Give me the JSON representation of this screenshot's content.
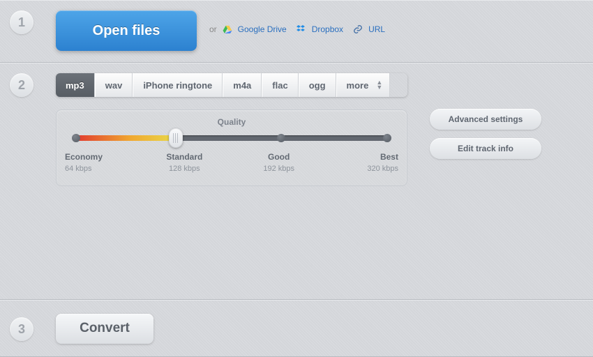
{
  "steps": {
    "one": "1",
    "two": "2",
    "three": "3"
  },
  "open": {
    "label": "Open files",
    "or": "or"
  },
  "sources": {
    "gdrive": "Google Drive",
    "dropbox": "Dropbox",
    "url": "URL"
  },
  "formats": {
    "mp3": "mp3",
    "wav": "wav",
    "iphone": "iPhone ringtone",
    "m4a": "m4a",
    "flac": "flac",
    "ogg": "ogg",
    "more": "more"
  },
  "quality": {
    "title": "Quality",
    "levels": [
      {
        "name": "Economy",
        "rate": "64 kbps"
      },
      {
        "name": "Standard",
        "rate": "128 kbps"
      },
      {
        "name": "Good",
        "rate": "192 kbps"
      },
      {
        "name": "Best",
        "rate": "320 kbps"
      }
    ]
  },
  "side": {
    "advanced": "Advanced settings",
    "edit": "Edit track info"
  },
  "convert": {
    "label": "Convert"
  }
}
